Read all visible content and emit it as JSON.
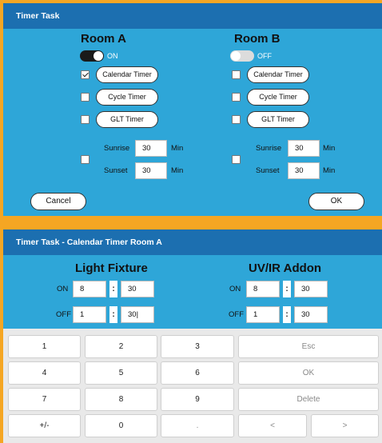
{
  "dialog_a": {
    "title": "Timer Task",
    "room_a": {
      "name": "Room A",
      "toggle_label": "ON",
      "calendar_timer": "Calendar Timer",
      "cycle_timer": "Cycle Timer",
      "glt_timer": "GLT Timer",
      "sunrise_label": "Sunrise",
      "sunrise_value": "30",
      "sunrise_unit": "Min",
      "sunset_label": "Sunset",
      "sunset_value": "30",
      "sunset_unit": "Min"
    },
    "room_b": {
      "name": "Room B",
      "toggle_label": "OFF",
      "calendar_timer": "Calendar Timer",
      "cycle_timer": "Cycle Timer",
      "glt_timer": "GLT Timer",
      "sunrise_label": "Sunrise",
      "sunrise_value": "30",
      "sunrise_unit": "Min",
      "sunset_label": "Sunset",
      "sunset_value": "30",
      "sunset_unit": "Min"
    },
    "cancel_label": "Cancel",
    "ok_label": "OK"
  },
  "dialog_b": {
    "title": "Timer Task - Calendar Timer Room A",
    "light_fixture": {
      "name": "Light Fixture",
      "on_label": "ON",
      "on_hour": "8",
      "on_minute": "30",
      "off_label": "OFF",
      "off_hour": "1",
      "off_minute": "30|"
    },
    "uv_ir_addon": {
      "name": "UV/IR Addon",
      "on_label": "ON",
      "on_hour": "8",
      "on_minute": "30",
      "off_label": "OFF",
      "off_hour": "1",
      "off_minute": "30"
    },
    "colon": ":"
  },
  "keypad": {
    "row1": [
      "1",
      "2",
      "3",
      "Esc"
    ],
    "row2": [
      "4",
      "5",
      "6",
      "OK"
    ],
    "row3": [
      "7",
      "8",
      "9",
      "Delete"
    ],
    "row4": [
      "+/-",
      "0",
      ".",
      "<",
      ">"
    ]
  },
  "colors": {
    "frame": "#f5a623",
    "titlebar": "#1c6fb0",
    "dialog_body": "#2ea6d8",
    "keypad_bg": "#e9e9e9"
  }
}
